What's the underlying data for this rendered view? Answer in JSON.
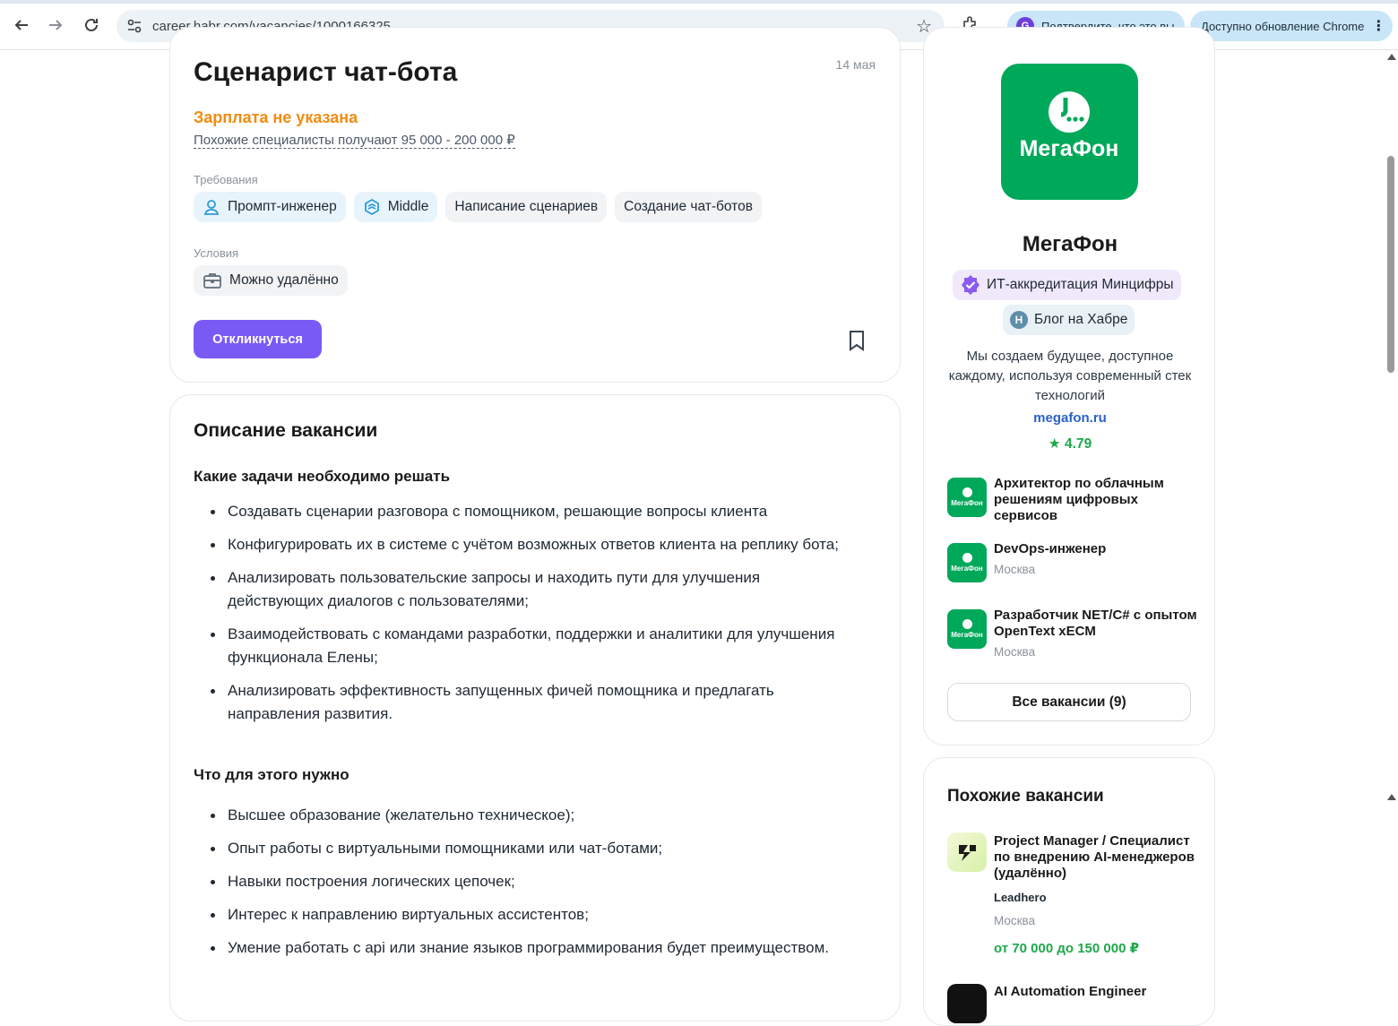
{
  "browser": {
    "url": "career.habr.com/vacancies/1000166325",
    "verify_label": "Подтвердите, что это вы",
    "verify_avatar": "G",
    "update_label": "Доступно обновление Chrome"
  },
  "vacancy": {
    "title": "Сценарист чат-бота",
    "date": "14 мая",
    "salary": "Зарплата не указана",
    "salary_hint": "Похожие специалисты получают 95 000 - 200 000 ₽",
    "requirements_label": "Требования",
    "requirements": [
      "Промпт-инженер",
      "Middle",
      "Написание сценариев",
      "Создание чат-ботов"
    ],
    "conditions_label": "Условия",
    "conditions": [
      "Можно удалённо"
    ],
    "apply_label": "Откликнуться"
  },
  "description": {
    "heading": "Описание вакансии",
    "tasks_heading": "Какие задачи необходимо решать",
    "tasks": [
      "Создавать сценарии разговора с помощником, решающие вопросы клиента",
      "Конфигурировать их в системе с учётом возможных ответов клиента на реплику бота;",
      "Анализировать пользовательские запросы и находить пути для улучшения действующих диалогов с пользователями;",
      "Взаимодействовать с командами разработки, поддержки и аналитики для улучшения функционала Елены;",
      "Анализировать эффективность запущенных фичей помощника и предлагать направления развития."
    ],
    "needs_heading": "Что для этого нужно",
    "needs": [
      "Высшее образование (желательно техническое);",
      "Опыт работы с виртуальными помощниками или чат-ботами;",
      "Навыки построения логических цепочек;",
      "Интерес к направлению виртуальных ассистентов;",
      "Умение работать с api или знание языков программирования будет преимуществом."
    ]
  },
  "company": {
    "logo_text": "МегаФон",
    "name": "МегаФон",
    "accreditation": "ИТ-аккредитация Минцифры",
    "blog": "Блог на Хабре",
    "blog_icon": "H",
    "about": "Мы создаем будущее, доступное каждому, используя современный стек технологий",
    "site": "megafon.ru",
    "rating": "4.79",
    "small_logo_text": "МегаФон",
    "jobs": [
      {
        "title": "Архитектор по облачным решениям цифровых сервисов",
        "city": ""
      },
      {
        "title": "DevOps-инженер",
        "city": "Москва"
      },
      {
        "title": "Разработчик NET/C# с опытом OpenText xECM",
        "city": "Москва"
      }
    ],
    "all_jobs_label": "Все вакансии (9)"
  },
  "similar": {
    "heading": "Похожие вакансии",
    "items": [
      {
        "title": "Project Manager / Специалист по внедрению AI-менеджеров (удалённо)",
        "company": "Leadhero",
        "city": "Москва",
        "salary": "от 70 000 до 150 000 ₽"
      },
      {
        "title": "AI Automation Engineer"
      }
    ]
  },
  "colors": {
    "accent": "#7a5af5",
    "salary": "#f28c0f",
    "brand_green": "#00a85a",
    "link": "#2b62c7",
    "rating": "#1ea84a"
  }
}
